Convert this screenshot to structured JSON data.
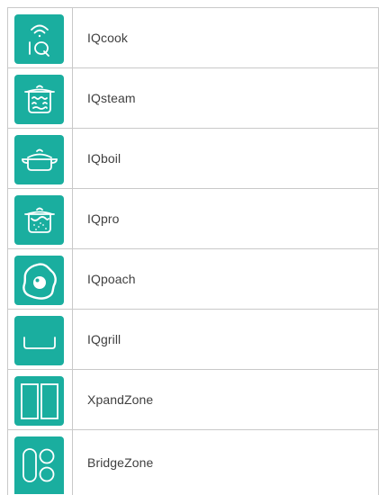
{
  "features": [
    {
      "name": "IQcook",
      "icon": "iqcook-icon"
    },
    {
      "name": "IQsteam",
      "icon": "steam-pot-icon"
    },
    {
      "name": "IQboil",
      "icon": "boil-pot-icon"
    },
    {
      "name": "IQpro",
      "icon": "pro-pot-icon"
    },
    {
      "name": "IQpoach",
      "icon": "poached-egg-icon"
    },
    {
      "name": "IQgrill",
      "icon": "grill-tray-icon"
    },
    {
      "name": "XpandZone",
      "icon": "xpand-zone-icon"
    },
    {
      "name": "BridgeZone",
      "icon": "bridge-zone-icon"
    }
  ],
  "colors": {
    "accent": "#1aae9f",
    "border": "#c9c9c9",
    "text": "#3f3f3f"
  }
}
